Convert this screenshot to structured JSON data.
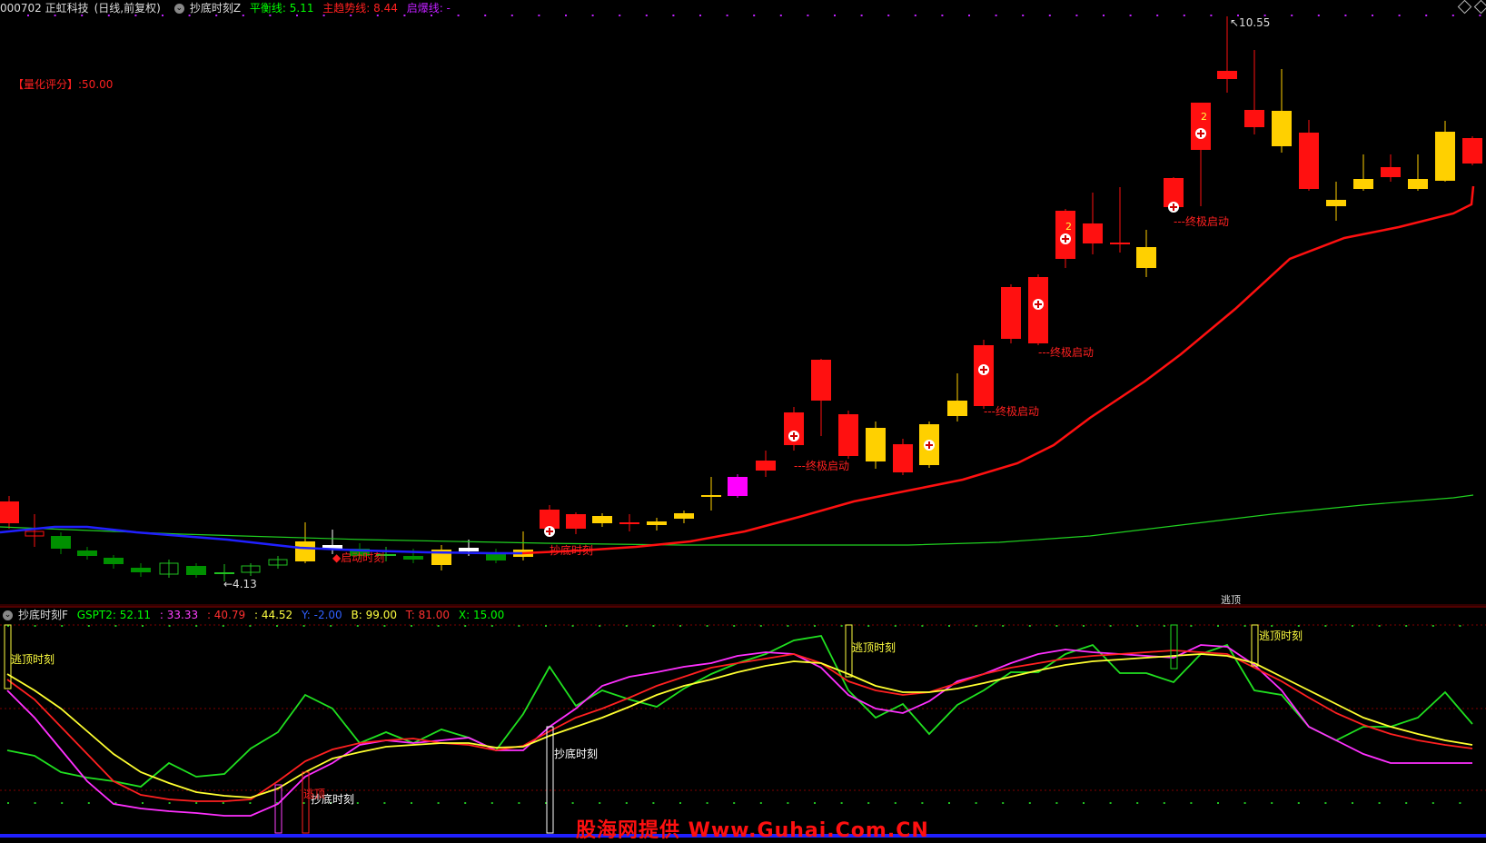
{
  "header": {
    "code_name": "000702 正虹科技",
    "period": "(日线,前复权)",
    "indicator": "抄底时刻Z",
    "lines": [
      {
        "label": "平衡线: 5.11",
        "color": "#00ff00"
      },
      {
        "label": "主趋势线: 8.44",
        "color": "#ff2020"
      },
      {
        "label": "启爆线: -",
        "color": "#c020ff"
      }
    ]
  },
  "score_label": "【量化评分】:50.00",
  "price_high_label": "10.55",
  "price_low_label": "4.13",
  "annotations": {
    "launch": "---终极启动",
    "bottom": "抄底时刻",
    "top_escape": "逃顶时刻",
    "start": "启动时刻",
    "escape_short": "逃顶",
    "two": "2"
  },
  "sub_header": {
    "indicator": "抄底时刻F",
    "values": [
      {
        "label": "GSPT2: 52.11",
        "color": "#00ff00"
      },
      {
        "label": ": 33.33",
        "color": "#ff40ff"
      },
      {
        "label": ": 40.79",
        "color": "#ff3030"
      },
      {
        "label": ": 44.52",
        "color": "#ffff40"
      },
      {
        "label": "Y: -2.00",
        "color": "#3060ff"
      },
      {
        "label": "B: 99.00",
        "color": "#ffff40"
      },
      {
        "label": "T: 81.00",
        "color": "#ff3030"
      },
      {
        "label": "X: 15.00",
        "color": "#00ff00"
      }
    ]
  },
  "watermark": "股海网提供 Www.Guhai.Com.CN",
  "colors": {
    "up": "#ff1010",
    "down": "#009000",
    "yellow": "#ffd000",
    "magenta": "#ff00ff",
    "white": "#ffffff",
    "balance_line": "#20d020",
    "trend_line": "#ff1010",
    "blue_line": "#2020ff"
  }
}
